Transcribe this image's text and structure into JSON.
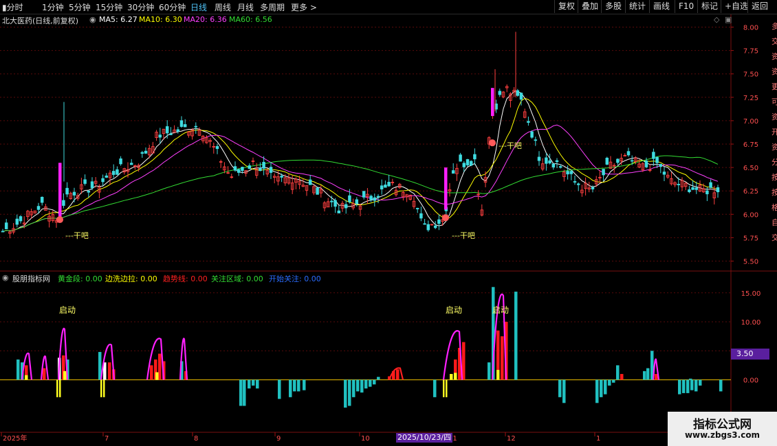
{
  "toolbar": {
    "periods": [
      "分时",
      "1分钟",
      "5分钟",
      "15分钟",
      "30分钟",
      "60分钟",
      "日线",
      "周线",
      "月线",
      "多周期",
      "更多"
    ],
    "active": "日线",
    "right_buttons": [
      "复权",
      "叠加",
      "多股",
      "统计",
      "画线",
      "F10",
      "标记",
      "+自选",
      "返回"
    ]
  },
  "stock": {
    "title": "北大医药(日线,前复权)",
    "ma": [
      {
        "label": "MA5: 6.27",
        "color": "#ffffff"
      },
      {
        "label": "MA10: 6.30",
        "color": "#ffff00"
      },
      {
        "label": "MA20: 6.36",
        "color": "#ff40ff"
      },
      {
        "label": "MA60: 6.56",
        "color": "#33dd33"
      }
    ]
  },
  "indicator": {
    "name": "股朋指标网",
    "items": [
      {
        "label": "黄金段: 0.00",
        "color": "#33dd33"
      },
      {
        "label": "边洗边拉: 0.00",
        "color": "#ffff00"
      },
      {
        "label": "趋势线: 0.00",
        "color": "#ff2020"
      },
      {
        "label": "关注区域: 0.00",
        "color": "#33dd33"
      },
      {
        "label": "开始关注: 0.00",
        "color": "#2a6cff"
      }
    ],
    "signal_label": "启动",
    "current_value": "3.50"
  },
  "price_axis": [
    "8.00",
    "7.75",
    "7.50",
    "7.25",
    "7.00",
    "6.75",
    "6.50",
    "6.25",
    "6.00",
    "5.75",
    "5.50"
  ],
  "ind_axis": [
    "15.00",
    "10.00",
    "5.00",
    "0.00"
  ],
  "time_axis": [
    "2025年",
    "7",
    "8",
    "9",
    "10",
    "11",
    "12",
    "1"
  ],
  "selected_date": "2025/10/23/四",
  "annotations": [
    "干吧",
    "干吧",
    "干吧"
  ],
  "watermark": {
    "line1": "指标公式网",
    "line2": "www.zbgs3.com"
  },
  "right_edge_chars": [
    "多",
    "交",
    "资",
    "资",
    "更",
    "可",
    "资",
    "开",
    "资",
    "分",
    "按",
    "按",
    "格",
    "自",
    "交"
  ],
  "chart_data": {
    "type": "candlestick",
    "price_range": [
      5.5,
      8.0
    ],
    "ma_latest": {
      "MA5": 6.27,
      "MA10": 6.3,
      "MA20": 6.36,
      "MA60": 6.56
    },
    "ind_range": [
      0,
      15
    ]
  }
}
